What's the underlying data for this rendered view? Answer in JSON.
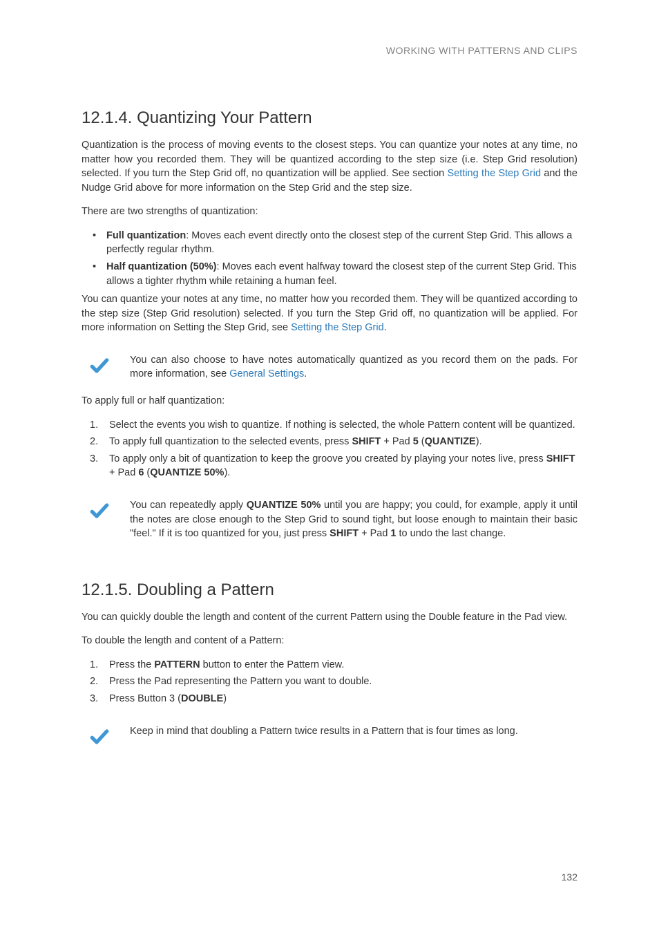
{
  "header": {
    "running": "WORKING WITH PATTERNS AND CLIPS"
  },
  "page_number": "132",
  "sec1": {
    "heading": "12.1.4. Quantizing Your Pattern",
    "p1_a": "Quantization is the process of moving events to the closest steps. You can quantize your notes at any time, no matter how you recorded them. They will be quantized according to the step size (i.e. Step Grid resolution) selected. If you turn the Step Grid off, no quantization will be applied. See section ",
    "p1_link": "Setting the Step Grid",
    "p1_b": " and the Nudge Grid above for more information on the Step Grid and the step size.",
    "p2": "There are two strengths of quantization:",
    "bul1_label": "Full quantization",
    "bul1_text": ": Moves each event directly onto the closest step of the current Step Grid. This allows a perfectly regular rhythm.",
    "bul2_label": "Half quantization (50%)",
    "bul2_text": ": Moves each event halfway toward the closest step of the current Step Grid. This allows a tighter rhythm while retaining a human feel.",
    "p3_a": "You can quantize your notes at any time, no matter how you recorded them. They will be quantized according to the step size (Step Grid resolution) selected. If you turn the Step Grid off, no quantization will be applied. For more information on Setting the Step Grid, see ",
    "p3_link": "Setting the Step Grid",
    "p3_b": ".",
    "tip1_a": "You can also choose to have notes automatically quantized as you record them on the pads. For more information, see ",
    "tip1_link": "General Settings",
    "tip1_b": ".",
    "p4": "To apply full or half quantization:",
    "st1": "Select the events you wish to quantize. If nothing is selected, the whole Pattern content will be quantized.",
    "st2_a": "To apply full quantization to the selected events, press ",
    "st2_b": "SHIFT",
    "st2_c": " + Pad ",
    "st2_d": "5",
    "st2_e": " (",
    "st2_f": "QUANTIZE",
    "st2_g": ").",
    "st3_a": "To apply only a bit of quantization to keep the groove you created by playing your notes live, press ",
    "st3_b": "SHIFT",
    "st3_c": " + Pad ",
    "st3_d": "6",
    "st3_e": " (",
    "st3_f": "QUANTIZE 50%",
    "st3_g": ").",
    "tip2_a": "You can repeatedly apply ",
    "tip2_b": "QUANTIZE 50%",
    "tip2_c": " until you are happy; you could, for example, apply it until the notes are close enough to the Step Grid to sound tight, but loose enough to maintain their basic \"feel.\" If it is too quantized for you, just press ",
    "tip2_d": "SHIFT",
    "tip2_e": " + Pad ",
    "tip2_f": "1",
    "tip2_g": " to undo the last change."
  },
  "sec2": {
    "heading": "12.1.5. Doubling a Pattern",
    "p1": "You can quickly double the length and content of the current Pattern using the Double feature in the Pad view.",
    "p2": "To double the length and content of a Pattern:",
    "st1_a": "Press the ",
    "st1_b": "PATTERN",
    "st1_c": " button to enter the Pattern view.",
    "st2": "Press the Pad representing the Pattern you want to double.",
    "st3_a": "Press Button 3 (",
    "st3_b": "DOUBLE",
    "st3_c": ")",
    "tip": "Keep in mind that doubling a Pattern twice results in a Pattern that is four times as long."
  }
}
